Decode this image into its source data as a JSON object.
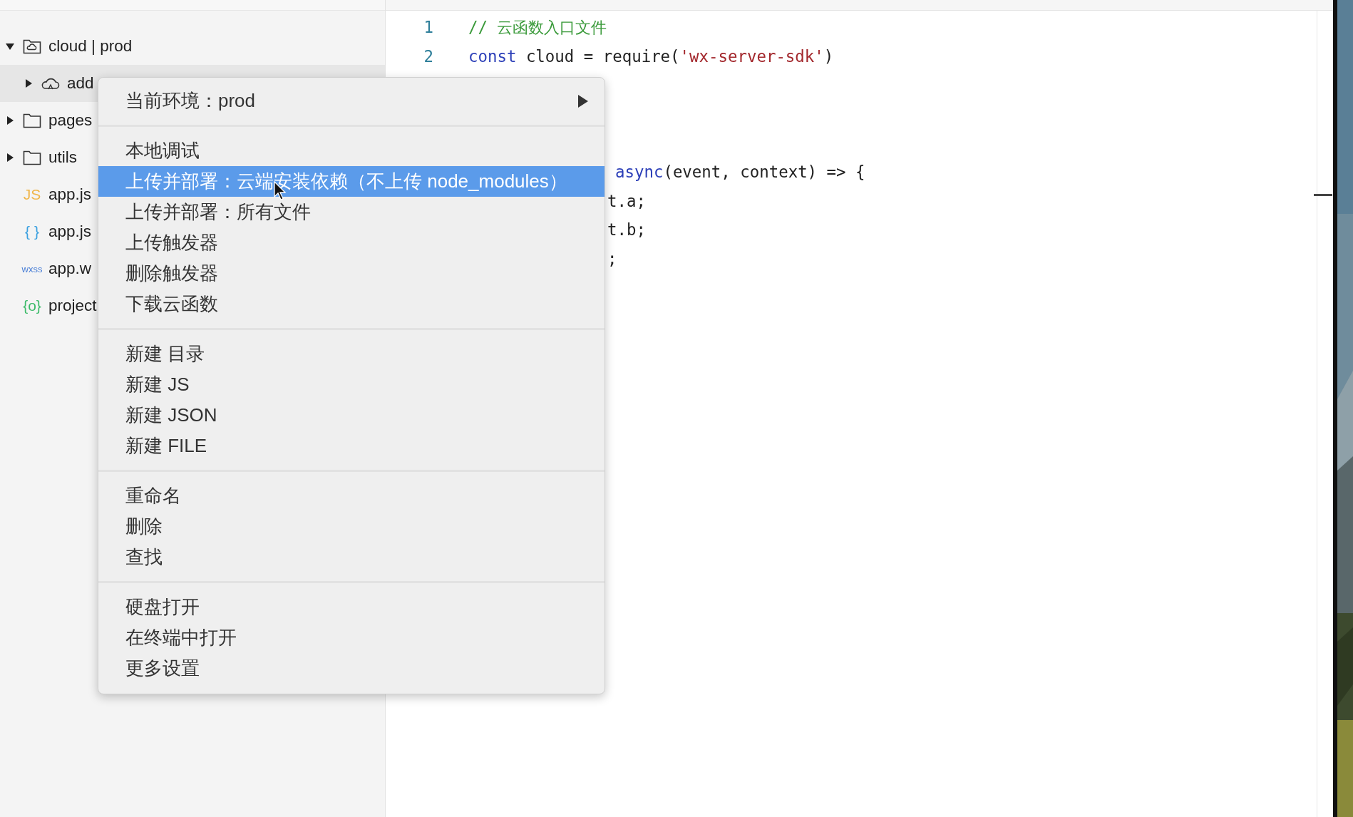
{
  "tree": [
    {
      "label": "cloud | prod",
      "kind": "cloud-folder",
      "expanded": true,
      "selected": false,
      "children": [
        {
          "label": "add",
          "kind": "cloud",
          "expanded": false,
          "selected": true
        }
      ]
    },
    {
      "label": "pages",
      "kind": "folder",
      "expanded": false,
      "selected": false
    },
    {
      "label": "utils",
      "kind": "folder",
      "expanded": false,
      "selected": false
    },
    {
      "label": "app.js",
      "kind": "file",
      "badge": "JS",
      "color": "#f0b64a",
      "selected": false
    },
    {
      "label": "app.js",
      "kind": "file",
      "badge": "{ }",
      "color": "#3aa0e0",
      "selected": false
    },
    {
      "label": "app.w",
      "kind": "file",
      "badge": "wxss",
      "color": "#4a7fd6",
      "selected": false
    },
    {
      "label": "project",
      "kind": "file",
      "badge": "{o}",
      "color": "#3dbb6a",
      "selected": false
    }
  ],
  "editor": {
    "lines": [
      {
        "kind": "full",
        "number": "1",
        "tokens": [
          {
            "kind": "comment",
            "text": "// 云函数入口文件"
          }
        ]
      },
      {
        "kind": "full",
        "number": "2",
        "tokens": [
          {
            "kind": "keyword",
            "text": "const"
          },
          {
            "kind": "plain",
            "text": " cloud = require("
          },
          {
            "kind": "string",
            "text": "'wx-server-sdk'"
          },
          {
            "kind": "plain",
            "text": ")"
          }
        ]
      },
      {
        "kind": "hidden"
      },
      {
        "kind": "hidden"
      },
      {
        "kind": "hidden"
      },
      {
        "kind": "partial",
        "tokens": [
          {
            "kind": "keyword",
            "text": "async"
          },
          {
            "kind": "plain",
            "text": "(event, context) => {"
          }
        ]
      },
      {
        "kind": "partial",
        "tokens": [
          {
            "kind": "plain",
            "text": "t.a;"
          }
        ]
      },
      {
        "kind": "partial",
        "tokens": [
          {
            "kind": "plain",
            "text": "t.b;"
          }
        ]
      },
      {
        "kind": "partial",
        "tokens": [
          {
            "kind": "plain",
            "text": ";"
          }
        ]
      }
    ]
  },
  "context_menu": {
    "groups": [
      [
        {
          "label": "当前环境：prod",
          "selected": false,
          "submenu": true
        }
      ],
      [
        {
          "label": "本地调试",
          "selected": false,
          "submenu": false
        },
        {
          "label": "上传并部署：云端安装依赖（不上传 node_modules）",
          "selected": true,
          "submenu": false
        },
        {
          "label": "上传并部署：所有文件",
          "selected": false,
          "submenu": false
        },
        {
          "label": "上传触发器",
          "selected": false,
          "submenu": false
        },
        {
          "label": "删除触发器",
          "selected": false,
          "submenu": false
        },
        {
          "label": "下载云函数",
          "selected": false,
          "submenu": false
        }
      ],
      [
        {
          "label": "新建 目录",
          "selected": false,
          "submenu": false
        },
        {
          "label": "新建 JS",
          "selected": false,
          "submenu": false
        },
        {
          "label": "新建 JSON",
          "selected": false,
          "submenu": false
        },
        {
          "label": "新建 FILE",
          "selected": false,
          "submenu": false
        }
      ],
      [
        {
          "label": "重命名",
          "selected": false,
          "submenu": false
        },
        {
          "label": "删除",
          "selected": false,
          "submenu": false
        },
        {
          "label": "查找",
          "selected": false,
          "submenu": false
        }
      ],
      [
        {
          "label": "硬盘打开",
          "selected": false,
          "submenu": false
        },
        {
          "label": "在终端中打开",
          "selected": false,
          "submenu": false
        },
        {
          "label": "更多设置",
          "selected": false,
          "submenu": false
        }
      ]
    ]
  }
}
